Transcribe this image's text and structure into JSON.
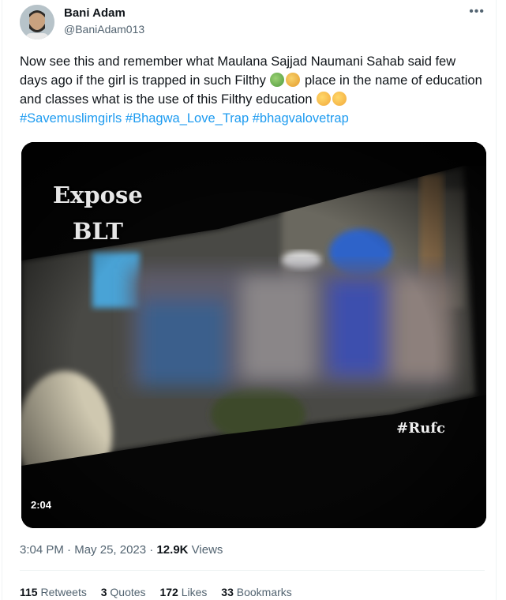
{
  "author": {
    "name": "Bani Adam",
    "handle": "@BaniAdam013",
    "more_icon": "more-horizontal-icon"
  },
  "tweet": {
    "text_1": "Now see this and remember what Maulana Sajjad Naumani Sahab said few days ago if the girl is trapped in such Filthy ",
    "text_2": " place in the name of education and classes what is the use of this Filthy education ",
    "emoji_1": "nauseated-green-face-emoji",
    "emoji_2": "vomiting-face-emoji",
    "emoji_3": "pensive-face-emoji",
    "hashtags": [
      "#Savemuslimgirls",
      "#Bhagwa_Love_Trap",
      "#bhagvalovetrap"
    ]
  },
  "video": {
    "overlay_line1": "Expose",
    "overlay_line2": "BLT",
    "corner_tag": "#Rufc",
    "duration": "2:04"
  },
  "meta": {
    "time": "3:04 PM",
    "date": "May 25, 2023",
    "views_count": "12.9K",
    "views_label": "Views"
  },
  "stats": {
    "retweets_count": "115",
    "retweets_label": "Retweets",
    "quotes_count": "3",
    "quotes_label": "Quotes",
    "likes_count": "172",
    "likes_label": "Likes",
    "bookmarks_count": "33",
    "bookmarks_label": "Bookmarks"
  }
}
